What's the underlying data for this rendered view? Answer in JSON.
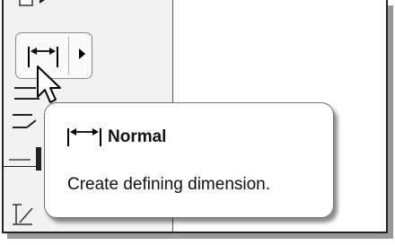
{
  "tooltip": {
    "title": "Normal",
    "description": "Create defining dimension."
  },
  "icons": {
    "main_tool": "dimension-normal-icon",
    "flyout": "flyout-arrow-icon",
    "cursor": "mouse-pointer-icon"
  },
  "colors": {
    "toolbar_bg": "#f2f2f2",
    "tooltip_border": "#6f6f6f"
  }
}
